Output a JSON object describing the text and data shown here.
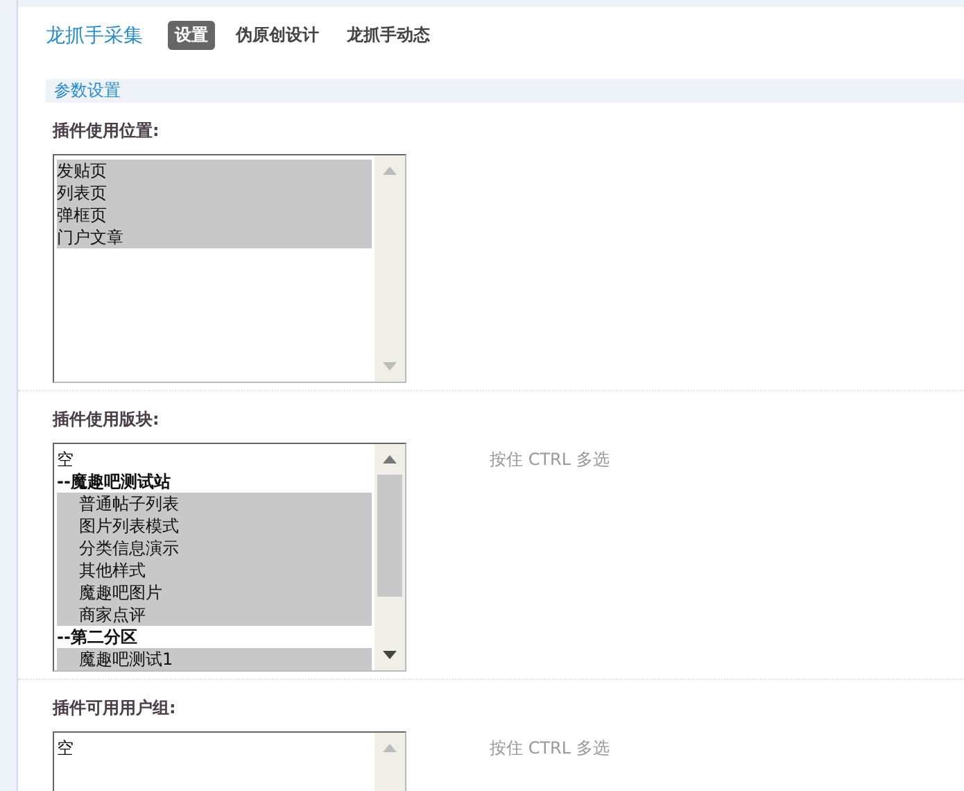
{
  "header": {
    "title": "龙抓手采集",
    "tabs": [
      {
        "label": "设置",
        "selected": true
      },
      {
        "label": "伪原创设计",
        "selected": false
      },
      {
        "label": "龙抓手动态",
        "selected": false
      }
    ]
  },
  "section": {
    "title": "参数设置"
  },
  "fields": [
    {
      "label": "插件使用位置:",
      "options": [
        {
          "label": "发贴页",
          "selected": true
        },
        {
          "label": "列表页",
          "selected": true
        },
        {
          "label": "弹框页",
          "selected": true
        },
        {
          "label": "门户文章",
          "selected": true
        }
      ]
    },
    {
      "label": "插件使用版块:",
      "hint": "按住 CTRL 多选",
      "options": [
        {
          "label": "空",
          "selected": false
        },
        {
          "label": "--魔趣吧测试站",
          "selected": false,
          "children": [
            {
              "label": "普通帖子列表",
              "selected": true
            },
            {
              "label": "图片列表模式",
              "selected": true
            },
            {
              "label": "分类信息演示",
              "selected": true
            },
            {
              "label": "其他样式",
              "selected": true
            },
            {
              "label": "魔趣吧图片",
              "selected": true
            },
            {
              "label": "商家点评",
              "selected": true
            }
          ]
        },
        {
          "label": "--第二分区",
          "selected": false,
          "children": [
            {
              "label": "魔趣吧测试1",
              "selected": true
            }
          ]
        }
      ]
    },
    {
      "label": "插件可用用户组:",
      "hint": "按住 CTRL 多选",
      "options": [
        {
          "label": "空",
          "selected": false
        }
      ]
    }
  ]
}
